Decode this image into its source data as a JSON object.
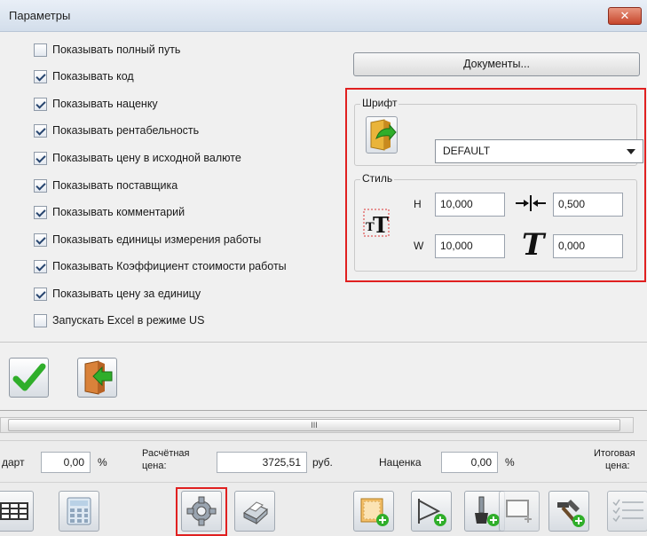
{
  "dialog": {
    "title": "Параметры",
    "close_label": "✕",
    "checkboxes": [
      {
        "label": "Показывать полный путь",
        "checked": false
      },
      {
        "label": "Показывать код",
        "checked": true
      },
      {
        "label": "Показывать наценку",
        "checked": true
      },
      {
        "label": "Показывать рентабельность",
        "checked": true
      },
      {
        "label": "Показывать цену в исходной валюте",
        "checked": true
      },
      {
        "label": "Показывать поставщика",
        "checked": true
      },
      {
        "label": "Показывать комментарий",
        "checked": true
      },
      {
        "label": "Показывать единицы измерения работы",
        "checked": true
      },
      {
        "label": "Показывать Коэффициент стоимости работы",
        "checked": true
      },
      {
        "label": "Показывать цену за единицу",
        "checked": true
      },
      {
        "label": "Запускать Excel в режиме US",
        "checked": false
      }
    ],
    "documents_button": "Документы...",
    "font_group": {
      "label": "Шрифт",
      "font_value": "DEFAULT"
    },
    "style_group": {
      "label": "Стиль",
      "h_label": "H",
      "h_value": "10,000",
      "w_label": "W",
      "w_value": "10,000",
      "spacing_value": "0,500",
      "italic_value": "0,000"
    }
  },
  "background": {
    "scroll_grip": "III",
    "row": {
      "cut_label": "дарт",
      "percent_value": "0,00",
      "percent_unit": "%",
      "calc_price_label_1": "Расчётная",
      "calc_price_label_2": "цена:",
      "calc_price_value": "3725,51",
      "currency": "руб.",
      "markup_label": "Наценка",
      "markup_value": "0,00",
      "markup_unit": "%",
      "total_label_1": "Итоговая",
      "total_label_2": "цена:"
    }
  },
  "colors": {
    "highlight": "#e02020",
    "check_green": "#2fae2a",
    "title_bar": "#dce5f0"
  }
}
